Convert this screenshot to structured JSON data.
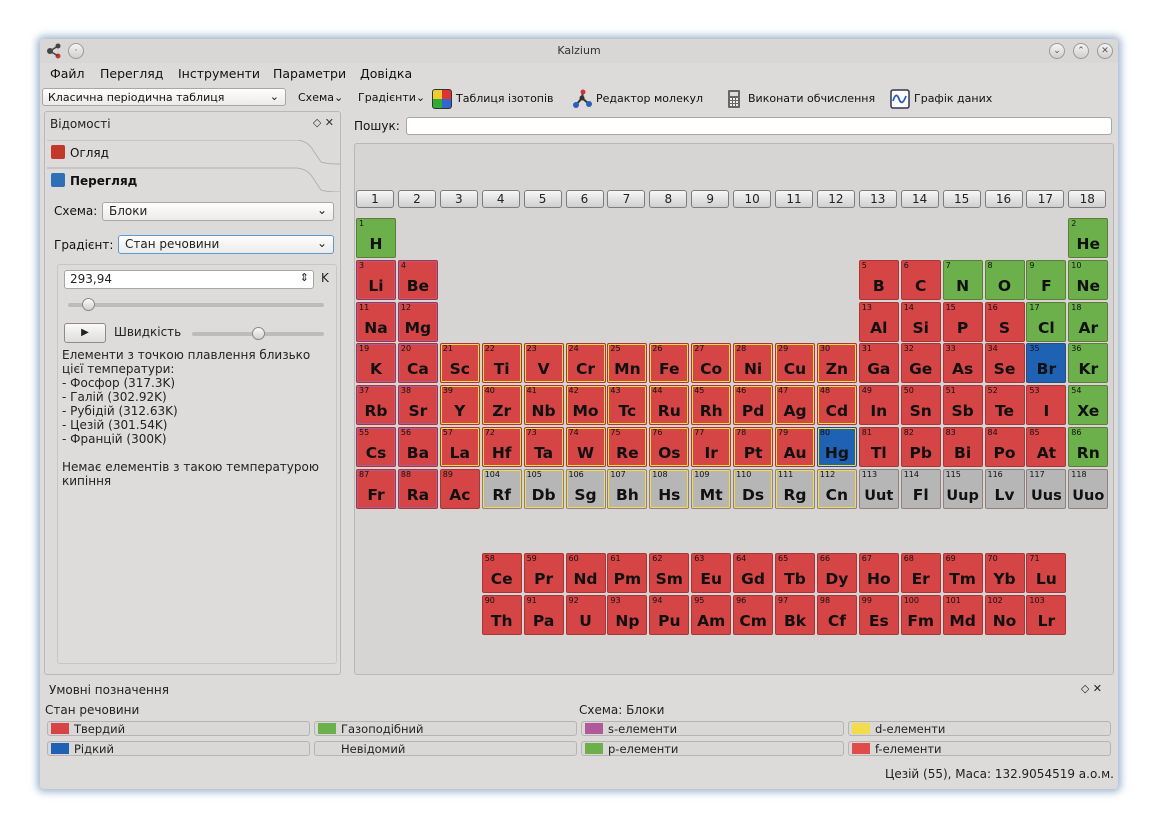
{
  "window": {
    "title": "Kalzium"
  },
  "menu": [
    "Файл",
    "Перегляд",
    "Інструменти",
    "Параметри",
    "Довідка"
  ],
  "toolbar": {
    "table_combo": "Класична періодична таблиця",
    "scheme": "Схема",
    "gradients": "Градієнти",
    "isotope_table": "Таблиця ізотопів",
    "molecule_editor": "Редактор молекул",
    "calculate": "Виконати обчислення",
    "data_plot": "Графік даних"
  },
  "sidebar": {
    "title": "Відомості",
    "tab_overview": "Огляд",
    "tab_view": "Перегляд",
    "scheme_label": "Схема:",
    "scheme_value": "Блоки",
    "gradient_label": "Градієнт:",
    "gradient_value": "Стан речовини",
    "temperature_value": "293,94",
    "temperature_unit": "K",
    "speed_label": "Швидкість",
    "melting_text": "Елементи з точкою плавлення близько цієї температури:",
    "melting_list": [
      "- Фосфор (317.3K)",
      "- Галій (302.92K)",
      "- Рубідій (312.63K)",
      "- Цезій (301.54K)",
      "- Францій (300K)"
    ],
    "boiling_text": "Немає елементів з такою температурою кипіння",
    "slider_level": 0.08,
    "speed_level": 0.5
  },
  "search": {
    "label": "Пошук:",
    "value": ""
  },
  "groups": [
    "1",
    "2",
    "3",
    "4",
    "5",
    "6",
    "7",
    "8",
    "9",
    "10",
    "11",
    "12",
    "13",
    "14",
    "15",
    "16",
    "17",
    "18"
  ],
  "colors": {
    "solid": "#d64545",
    "gas": "#6bb04a",
    "liquid": "#1f62b4",
    "unknown": "#b6b6b6",
    "s_block": "#b15a9a",
    "p_block": "#6bb04a",
    "d_block": "#f3dc4a",
    "f_block": "#e04c48"
  },
  "elements": [
    {
      "z": "1",
      "sym": "H",
      "row": 1,
      "col": 1,
      "state": "gas"
    },
    {
      "z": "2",
      "sym": "He",
      "row": 1,
      "col": 18,
      "state": "gas"
    },
    {
      "z": "3",
      "sym": "Li",
      "row": 2,
      "col": 1,
      "state": "solid",
      "block": "s"
    },
    {
      "z": "4",
      "sym": "Be",
      "row": 2,
      "col": 2,
      "state": "solid",
      "block": "s"
    },
    {
      "z": "5",
      "sym": "B",
      "row": 2,
      "col": 13,
      "state": "solid"
    },
    {
      "z": "6",
      "sym": "C",
      "row": 2,
      "col": 14,
      "state": "solid"
    },
    {
      "z": "7",
      "sym": "N",
      "row": 2,
      "col": 15,
      "state": "gas"
    },
    {
      "z": "8",
      "sym": "O",
      "row": 2,
      "col": 16,
      "state": "gas"
    },
    {
      "z": "9",
      "sym": "F",
      "row": 2,
      "col": 17,
      "state": "gas"
    },
    {
      "z": "10",
      "sym": "Ne",
      "row": 2,
      "col": 18,
      "state": "gas"
    },
    {
      "z": "11",
      "sym": "Na",
      "row": 3,
      "col": 1,
      "state": "solid",
      "block": "s"
    },
    {
      "z": "12",
      "sym": "Mg",
      "row": 3,
      "col": 2,
      "state": "solid",
      "block": "s"
    },
    {
      "z": "13",
      "sym": "Al",
      "row": 3,
      "col": 13,
      "state": "solid"
    },
    {
      "z": "14",
      "sym": "Si",
      "row": 3,
      "col": 14,
      "state": "solid"
    },
    {
      "z": "15",
      "sym": "P",
      "row": 3,
      "col": 15,
      "state": "solid"
    },
    {
      "z": "16",
      "sym": "S",
      "row": 3,
      "col": 16,
      "state": "solid"
    },
    {
      "z": "17",
      "sym": "Cl",
      "row": 3,
      "col": 17,
      "state": "gas"
    },
    {
      "z": "18",
      "sym": "Ar",
      "row": 3,
      "col": 18,
      "state": "gas"
    },
    {
      "z": "19",
      "sym": "K",
      "row": 4,
      "col": 1,
      "state": "solid",
      "block": "s"
    },
    {
      "z": "20",
      "sym": "Ca",
      "row": 4,
      "col": 2,
      "state": "solid",
      "block": "s"
    },
    {
      "z": "21",
      "sym": "Sc",
      "row": 4,
      "col": 3,
      "state": "solid",
      "block": "d"
    },
    {
      "z": "22",
      "sym": "Ti",
      "row": 4,
      "col": 4,
      "state": "solid",
      "block": "d"
    },
    {
      "z": "23",
      "sym": "V",
      "row": 4,
      "col": 5,
      "state": "solid",
      "block": "d"
    },
    {
      "z": "24",
      "sym": "Cr",
      "row": 4,
      "col": 6,
      "state": "solid",
      "block": "d"
    },
    {
      "z": "25",
      "sym": "Mn",
      "row": 4,
      "col": 7,
      "state": "solid",
      "block": "d"
    },
    {
      "z": "26",
      "sym": "Fe",
      "row": 4,
      "col": 8,
      "state": "solid",
      "block": "d"
    },
    {
      "z": "27",
      "sym": "Co",
      "row": 4,
      "col": 9,
      "state": "solid",
      "block": "d"
    },
    {
      "z": "28",
      "sym": "Ni",
      "row": 4,
      "col": 10,
      "state": "solid",
      "block": "d"
    },
    {
      "z": "29",
      "sym": "Cu",
      "row": 4,
      "col": 11,
      "state": "solid",
      "block": "d"
    },
    {
      "z": "30",
      "sym": "Zn",
      "row": 4,
      "col": 12,
      "state": "solid",
      "block": "d"
    },
    {
      "z": "31",
      "sym": "Ga",
      "row": 4,
      "col": 13,
      "state": "solid"
    },
    {
      "z": "32",
      "sym": "Ge",
      "row": 4,
      "col": 14,
      "state": "solid"
    },
    {
      "z": "33",
      "sym": "As",
      "row": 4,
      "col": 15,
      "state": "solid"
    },
    {
      "z": "34",
      "sym": "Se",
      "row": 4,
      "col": 16,
      "state": "solid"
    },
    {
      "z": "35",
      "sym": "Br",
      "row": 4,
      "col": 17,
      "state": "liquid"
    },
    {
      "z": "36",
      "sym": "Kr",
      "row": 4,
      "col": 18,
      "state": "gas"
    },
    {
      "z": "37",
      "sym": "Rb",
      "row": 5,
      "col": 1,
      "state": "solid",
      "block": "s"
    },
    {
      "z": "38",
      "sym": "Sr",
      "row": 5,
      "col": 2,
      "state": "solid",
      "block": "s"
    },
    {
      "z": "39",
      "sym": "Y",
      "row": 5,
      "col": 3,
      "state": "solid",
      "block": "d"
    },
    {
      "z": "40",
      "sym": "Zr",
      "row": 5,
      "col": 4,
      "state": "solid",
      "block": "d"
    },
    {
      "z": "41",
      "sym": "Nb",
      "row": 5,
      "col": 5,
      "state": "solid",
      "block": "d"
    },
    {
      "z": "42",
      "sym": "Mo",
      "row": 5,
      "col": 6,
      "state": "solid",
      "block": "d"
    },
    {
      "z": "43",
      "sym": "Tc",
      "row": 5,
      "col": 7,
      "state": "solid",
      "block": "d"
    },
    {
      "z": "44",
      "sym": "Ru",
      "row": 5,
      "col": 8,
      "state": "solid",
      "block": "d"
    },
    {
      "z": "45",
      "sym": "Rh",
      "row": 5,
      "col": 9,
      "state": "solid",
      "block": "d"
    },
    {
      "z": "46",
      "sym": "Pd",
      "row": 5,
      "col": 10,
      "state": "solid",
      "block": "d"
    },
    {
      "z": "47",
      "sym": "Ag",
      "row": 5,
      "col": 11,
      "state": "solid",
      "block": "d"
    },
    {
      "z": "48",
      "sym": "Cd",
      "row": 5,
      "col": 12,
      "state": "solid",
      "block": "d"
    },
    {
      "z": "49",
      "sym": "In",
      "row": 5,
      "col": 13,
      "state": "solid"
    },
    {
      "z": "50",
      "sym": "Sn",
      "row": 5,
      "col": 14,
      "state": "solid"
    },
    {
      "z": "51",
      "sym": "Sb",
      "row": 5,
      "col": 15,
      "state": "solid"
    },
    {
      "z": "52",
      "sym": "Te",
      "row": 5,
      "col": 16,
      "state": "solid"
    },
    {
      "z": "53",
      "sym": "I",
      "row": 5,
      "col": 17,
      "state": "solid"
    },
    {
      "z": "54",
      "sym": "Xe",
      "row": 5,
      "col": 18,
      "state": "gas"
    },
    {
      "z": "55",
      "sym": "Cs",
      "row": 6,
      "col": 1,
      "state": "solid",
      "block": "s"
    },
    {
      "z": "56",
      "sym": "Ba",
      "row": 6,
      "col": 2,
      "state": "solid",
      "block": "s"
    },
    {
      "z": "57",
      "sym": "La",
      "row": 6,
      "col": 3,
      "state": "solid",
      "block": "d"
    },
    {
      "z": "72",
      "sym": "Hf",
      "row": 6,
      "col": 4,
      "state": "solid",
      "block": "d"
    },
    {
      "z": "73",
      "sym": "Ta",
      "row": 6,
      "col": 5,
      "state": "solid",
      "block": "d"
    },
    {
      "z": "74",
      "sym": "W",
      "row": 6,
      "col": 6,
      "state": "solid",
      "block": "d"
    },
    {
      "z": "75",
      "sym": "Re",
      "row": 6,
      "col": 7,
      "state": "solid",
      "block": "d"
    },
    {
      "z": "76",
      "sym": "Os",
      "row": 6,
      "col": 8,
      "state": "solid",
      "block": "d"
    },
    {
      "z": "77",
      "sym": "Ir",
      "row": 6,
      "col": 9,
      "state": "solid",
      "block": "d"
    },
    {
      "z": "78",
      "sym": "Pt",
      "row": 6,
      "col": 10,
      "state": "solid",
      "block": "d"
    },
    {
      "z": "79",
      "sym": "Au",
      "row": 6,
      "col": 11,
      "state": "solid",
      "block": "d"
    },
    {
      "z": "80",
      "sym": "Hg",
      "row": 6,
      "col": 12,
      "state": "liquid",
      "block": "d"
    },
    {
      "z": "81",
      "sym": "Tl",
      "row": 6,
      "col": 13,
      "state": "solid"
    },
    {
      "z": "82",
      "sym": "Pb",
      "row": 6,
      "col": 14,
      "state": "solid"
    },
    {
      "z": "83",
      "sym": "Bi",
      "row": 6,
      "col": 15,
      "state": "solid"
    },
    {
      "z": "84",
      "sym": "Po",
      "row": 6,
      "col": 16,
      "state": "solid"
    },
    {
      "z": "85",
      "sym": "At",
      "row": 6,
      "col": 17,
      "state": "solid"
    },
    {
      "z": "86",
      "sym": "Rn",
      "row": 6,
      "col": 18,
      "state": "gas"
    },
    {
      "z": "87",
      "sym": "Fr",
      "row": 7,
      "col": 1,
      "state": "solid",
      "block": "s"
    },
    {
      "z": "88",
      "sym": "Ra",
      "row": 7,
      "col": 2,
      "state": "solid",
      "block": "s"
    },
    {
      "z": "89",
      "sym": "Ac",
      "row": 7,
      "col": 3,
      "state": "solid"
    },
    {
      "z": "104",
      "sym": "Rf",
      "row": 7,
      "col": 4,
      "state": "unknown",
      "block": "d"
    },
    {
      "z": "105",
      "sym": "Db",
      "row": 7,
      "col": 5,
      "state": "unknown",
      "block": "d"
    },
    {
      "z": "106",
      "sym": "Sg",
      "row": 7,
      "col": 6,
      "state": "unknown",
      "block": "d"
    },
    {
      "z": "107",
      "sym": "Bh",
      "row": 7,
      "col": 7,
      "state": "unknown",
      "block": "d"
    },
    {
      "z": "108",
      "sym": "Hs",
      "row": 7,
      "col": 8,
      "state": "unknown",
      "block": "d"
    },
    {
      "z": "109",
      "sym": "Mt",
      "row": 7,
      "col": 9,
      "state": "unknown",
      "block": "d"
    },
    {
      "z": "110",
      "sym": "Ds",
      "row": 7,
      "col": 10,
      "state": "unknown",
      "block": "d"
    },
    {
      "z": "111",
      "sym": "Rg",
      "row": 7,
      "col": 11,
      "state": "unknown",
      "block": "d"
    },
    {
      "z": "112",
      "sym": "Cn",
      "row": 7,
      "col": 12,
      "state": "unknown",
      "block": "d"
    },
    {
      "z": "113",
      "sym": "Uut",
      "row": 7,
      "col": 13,
      "state": "unknown"
    },
    {
      "z": "114",
      "sym": "Fl",
      "row": 7,
      "col": 14,
      "state": "unknown"
    },
    {
      "z": "115",
      "sym": "Uup",
      "row": 7,
      "col": 15,
      "state": "unknown"
    },
    {
      "z": "116",
      "sym": "Lv",
      "row": 7,
      "col": 16,
      "state": "unknown"
    },
    {
      "z": "117",
      "sym": "Uus",
      "row": 7,
      "col": 17,
      "state": "unknown"
    },
    {
      "z": "118",
      "sym": "Uuo",
      "row": 7,
      "col": 18,
      "state": "unknown"
    },
    {
      "z": "58",
      "sym": "Ce",
      "row": 9,
      "col": 4,
      "state": "solid"
    },
    {
      "z": "59",
      "sym": "Pr",
      "row": 9,
      "col": 5,
      "state": "solid"
    },
    {
      "z": "60",
      "sym": "Nd",
      "row": 9,
      "col": 6,
      "state": "solid"
    },
    {
      "z": "61",
      "sym": "Pm",
      "row": 9,
      "col": 7,
      "state": "solid"
    },
    {
      "z": "62",
      "sym": "Sm",
      "row": 9,
      "col": 8,
      "state": "solid"
    },
    {
      "z": "63",
      "sym": "Eu",
      "row": 9,
      "col": 9,
      "state": "solid"
    },
    {
      "z": "64",
      "sym": "Gd",
      "row": 9,
      "col": 10,
      "state": "solid"
    },
    {
      "z": "65",
      "sym": "Tb",
      "row": 9,
      "col": 11,
      "state": "solid"
    },
    {
      "z": "66",
      "sym": "Dy",
      "row": 9,
      "col": 12,
      "state": "solid"
    },
    {
      "z": "67",
      "sym": "Ho",
      "row": 9,
      "col": 13,
      "state": "solid"
    },
    {
      "z": "68",
      "sym": "Er",
      "row": 9,
      "col": 14,
      "state": "solid"
    },
    {
      "z": "69",
      "sym": "Tm",
      "row": 9,
      "col": 15,
      "state": "solid"
    },
    {
      "z": "70",
      "sym": "Yb",
      "row": 9,
      "col": 16,
      "state": "solid"
    },
    {
      "z": "71",
      "sym": "Lu",
      "row": 9,
      "col": 17,
      "state": "solid"
    },
    {
      "z": "90",
      "sym": "Th",
      "row": 10,
      "col": 4,
      "state": "solid"
    },
    {
      "z": "91",
      "sym": "Pa",
      "row": 10,
      "col": 5,
      "state": "solid"
    },
    {
      "z": "92",
      "sym": "U",
      "row": 10,
      "col": 6,
      "state": "solid"
    },
    {
      "z": "93",
      "sym": "Np",
      "row": 10,
      "col": 7,
      "state": "solid"
    },
    {
      "z": "94",
      "sym": "Pu",
      "row": 10,
      "col": 8,
      "state": "solid"
    },
    {
      "z": "95",
      "sym": "Am",
      "row": 10,
      "col": 9,
      "state": "solid"
    },
    {
      "z": "96",
      "sym": "Cm",
      "row": 10,
      "col": 10,
      "state": "solid"
    },
    {
      "z": "97",
      "sym": "Bk",
      "row": 10,
      "col": 11,
      "state": "solid"
    },
    {
      "z": "98",
      "sym": "Cf",
      "row": 10,
      "col": 12,
      "state": "solid"
    },
    {
      "z": "99",
      "sym": "Es",
      "row": 10,
      "col": 13,
      "state": "solid"
    },
    {
      "z": "100",
      "sym": "Fm",
      "row": 10,
      "col": 14,
      "state": "solid"
    },
    {
      "z": "101",
      "sym": "Md",
      "row": 10,
      "col": 15,
      "state": "solid"
    },
    {
      "z": "102",
      "sym": "No",
      "row": 10,
      "col": 16,
      "state": "solid"
    },
    {
      "z": "103",
      "sym": "Lr",
      "row": 10,
      "col": 17,
      "state": "solid"
    }
  ],
  "legend": {
    "title": "Умовні позначення",
    "state_heading": "Стан речовини",
    "scheme_heading": "Схема: Блоки",
    "solid": "Твердий",
    "gas": "Газоподібний",
    "liquid": "Рідкий",
    "unknown": "Невідомий",
    "s": "s-елементи",
    "p": "p-елементи",
    "d": "d-елементи",
    "f": "f-елементи"
  },
  "status": "Цезій (55), Маса: 132.9054519 а.о.м."
}
